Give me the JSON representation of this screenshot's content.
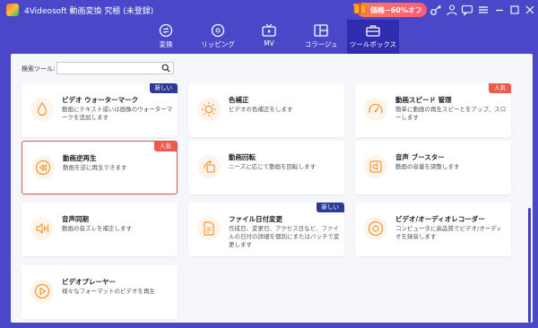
{
  "window": {
    "title": "4Videosoft 動画変換 究極 (未登録)",
    "promo_text": "価格−60%オフ"
  },
  "nav": {
    "tabs": [
      {
        "label": "変換",
        "icon": "convert-icon"
      },
      {
        "label": "リッピング",
        "icon": "disc-icon"
      },
      {
        "label": "MV",
        "icon": "tv-icon"
      },
      {
        "label": "コラージュ",
        "icon": "collage-icon"
      },
      {
        "label": "ツールボックス",
        "icon": "toolbox-icon",
        "active": true
      }
    ]
  },
  "search": {
    "label": "検索ツール:",
    "value": "",
    "placeholder": ""
  },
  "tools": [
    {
      "title": "ビデオ ウォーターマーク",
      "desc": "動画にテキスト或いは画像のウォーターマークを追加します",
      "badge": "新しい",
      "badge_type": "new",
      "icon": "droplet-icon"
    },
    {
      "title": "色補正",
      "desc": "ビデオの色補正をします",
      "badge": "",
      "badge_type": "",
      "icon": "sun-icon"
    },
    {
      "title": "動画スピード 管理",
      "desc": "簡単に動画の再生スピーとをアップ、スローします",
      "badge": "人気",
      "badge_type": "hot",
      "icon": "speedometer-icon"
    },
    {
      "title": "動画逆再生",
      "desc": "動画を逆に再生できます",
      "badge": "人気",
      "badge_type": "hot",
      "icon": "rewind-icon",
      "selected": true
    },
    {
      "title": "動画回転",
      "desc": "ニーズに応じて動画を回転します",
      "badge": "",
      "badge_type": "",
      "icon": "rotate-icon"
    },
    {
      "title": "音声 ブースター",
      "desc": "動画の音量を調整します",
      "badge": "",
      "badge_type": "",
      "icon": "speaker-icon"
    },
    {
      "title": "音声同期",
      "desc": "動画の音ズレを補正します",
      "badge": "",
      "badge_type": "",
      "icon": "audio-sync-icon"
    },
    {
      "title": "ファイル日付変更",
      "desc": "作成日、変更日、アクセス日など、ファイルの日付の詳細を個別にまたはバッチで変更します",
      "badge": "新しい",
      "badge_type": "new",
      "icon": "file-date-icon"
    },
    {
      "title": "ビデオ/オーディオレコーダー",
      "desc": "コンピュータに高品質でビデオ/オーディオを録音します",
      "badge": "",
      "badge_type": "",
      "icon": "recorder-icon"
    },
    {
      "title": "ビデオプレーヤー",
      "desc": "様々なフォーマットのビデオを再生",
      "badge": "",
      "badge_type": "",
      "icon": "play-icon"
    }
  ],
  "colors": {
    "titlebar": "#4a48c8",
    "active_tab": "#2f2cb0",
    "accent_orange": "#f29a3a",
    "badge_new": "#2e3a97",
    "badge_hot": "#ef5a4e"
  }
}
